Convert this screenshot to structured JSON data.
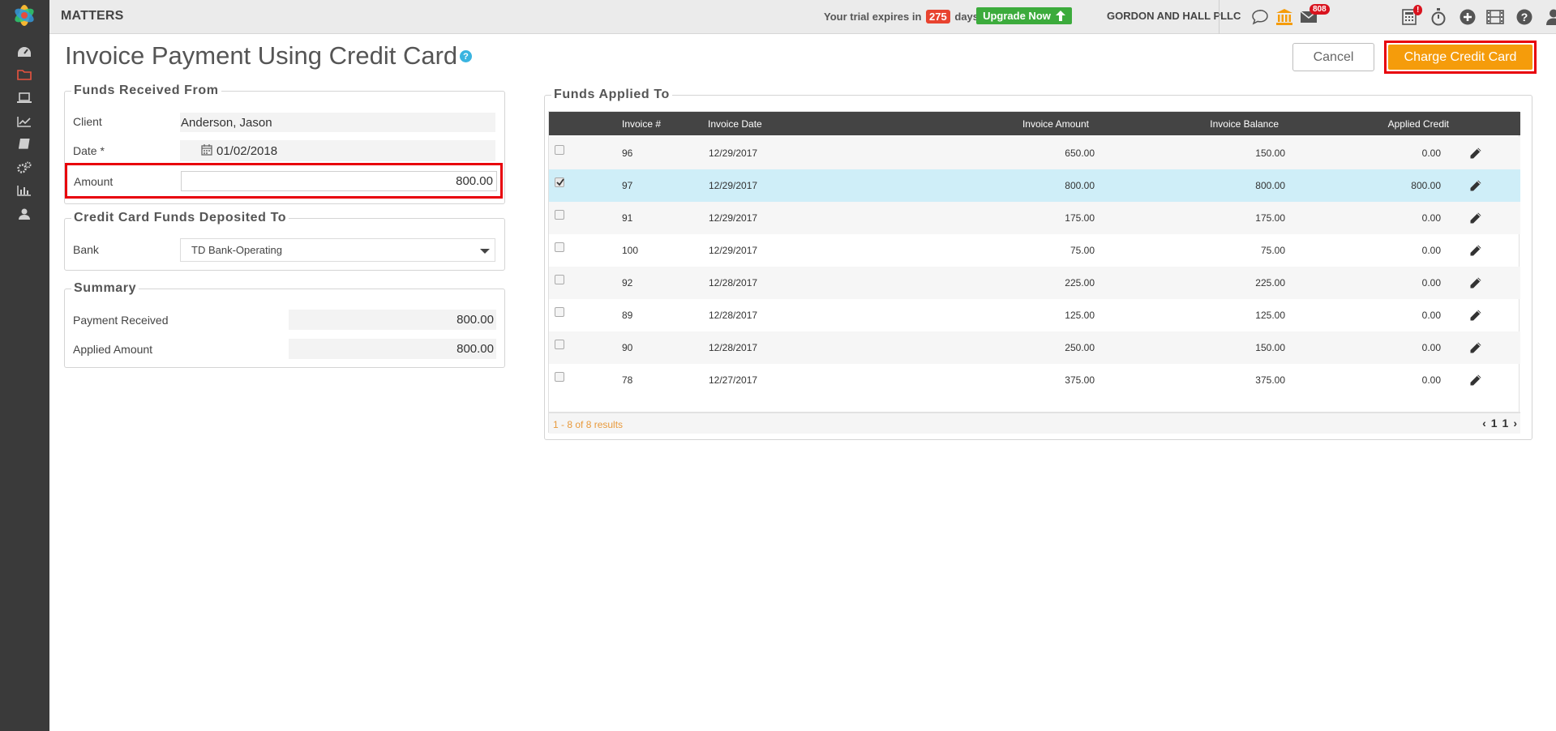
{
  "app": {
    "title": "MATTERS"
  },
  "topbar": {
    "trial_prefix": "Your trial expires in",
    "trial_days": "275",
    "trial_suffix": "days.",
    "upgrade_label": "Upgrade Now",
    "firm_name": "GORDON AND HALL PLLC",
    "mail_count": "808",
    "calc_alert": "!"
  },
  "page": {
    "title": "Invoice Payment Using Credit Card",
    "help": "?",
    "cancel_label": "Cancel",
    "charge_label": "Charge Credit Card"
  },
  "funds_received": {
    "legend": "Funds Received From",
    "client_label": "Client",
    "client_value": "Anderson, Jason",
    "date_label": "Date *",
    "date_value": "01/02/2018",
    "amount_label": "Amount",
    "amount_value": "800.00"
  },
  "deposit": {
    "legend": "Credit Card Funds Deposited To",
    "bank_label": "Bank",
    "bank_value": "TD Bank-Operating"
  },
  "summary": {
    "legend": "Summary",
    "payment_label": "Payment Received",
    "payment_value": "800.00",
    "applied_label": "Applied Amount",
    "applied_value": "800.00"
  },
  "funds_applied": {
    "legend": "Funds Applied To",
    "columns": [
      "Invoice #",
      "Invoice Date",
      "Invoice Amount",
      "Invoice Balance",
      "Applied Credit"
    ],
    "rows": [
      {
        "num": "96",
        "date": "12/29/2017",
        "amount": "650.00",
        "balance": "150.00",
        "applied": "0.00",
        "checked": false
      },
      {
        "num": "97",
        "date": "12/29/2017",
        "amount": "800.00",
        "balance": "800.00",
        "applied": "800.00",
        "checked": true
      },
      {
        "num": "91",
        "date": "12/29/2017",
        "amount": "175.00",
        "balance": "175.00",
        "applied": "0.00",
        "checked": false
      },
      {
        "num": "100",
        "date": "12/29/2017",
        "amount": "75.00",
        "balance": "75.00",
        "applied": "0.00",
        "checked": false
      },
      {
        "num": "92",
        "date": "12/28/2017",
        "amount": "225.00",
        "balance": "225.00",
        "applied": "0.00",
        "checked": false
      },
      {
        "num": "89",
        "date": "12/28/2017",
        "amount": "125.00",
        "balance": "125.00",
        "applied": "0.00",
        "checked": false
      },
      {
        "num": "90",
        "date": "12/28/2017",
        "amount": "250.00",
        "balance": "150.00",
        "applied": "0.00",
        "checked": false
      },
      {
        "num": "78",
        "date": "12/27/2017",
        "amount": "375.00",
        "balance": "375.00",
        "applied": "0.00",
        "checked": false
      }
    ],
    "results_text": "1 - 8 of 8 results",
    "page_current": "1",
    "page_total": "1"
  },
  "colors": {
    "sidebar": "#3a3a3a",
    "accent_orange": "#f59c0b",
    "highlight_red": "#e8000b",
    "upgrade_green": "#3cab3c",
    "selected_row": "#cfeef8"
  },
  "icons": {
    "sidebar": [
      "dashboard-icon",
      "folder-icon",
      "laptop-icon",
      "line-chart-icon",
      "book-icon",
      "gears-icon",
      "bar-chart-icon",
      "user-icon"
    ],
    "topbar": [
      "chat-icon",
      "bank-icon",
      "mail-icon",
      "calculator-icon",
      "stopwatch-icon",
      "plus-circle-icon",
      "film-icon",
      "help-circle-icon",
      "user-icon",
      "lightbulb-icon"
    ]
  }
}
